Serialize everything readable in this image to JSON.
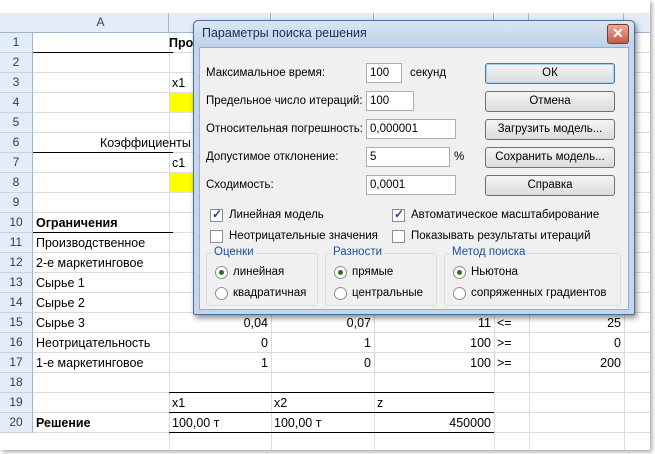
{
  "sheet": {
    "col_headers": [
      "A",
      "",
      "",
      "",
      "",
      ""
    ],
    "row_numbers": [
      "1",
      "2",
      "3",
      "4",
      "5",
      "6",
      "7",
      "8",
      "9",
      "10",
      "11",
      "12",
      "13",
      "14",
      "15",
      "16",
      "17",
      "18",
      "19",
      "20"
    ],
    "cells": {
      "b1": "Про",
      "c3_label": "x1",
      "a6": "Коэффициенты",
      "c7_label": "c1",
      "a10": "Ограничения",
      "a11": "Производственное",
      "a12": "2-е маркетинговое",
      "a13": "Сырье 1",
      "a14": "Сырье 2",
      "a15": "Сырье 3",
      "a16": "Неотрицательность",
      "a17": "1-е маркетинговое",
      "a20": "Решение",
      "r15": [
        "0,04",
        "0,07",
        "11",
        "<=",
        "25"
      ],
      "r16": [
        "0",
        "1",
        "100",
        ">=",
        "0"
      ],
      "r17": [
        "1",
        "0",
        "100",
        ">=",
        "200"
      ],
      "r19": [
        "x1",
        "x2",
        "z"
      ],
      "r20": [
        "100,00 т",
        "100,00 т",
        "450000"
      ]
    },
    "colors": {
      "highlight": "#ffff00",
      "header_bg": "#e4ecf7"
    }
  },
  "dialog": {
    "title": "Параметры поиска решения",
    "close_glyph": "✕",
    "fields": {
      "max_time_label": "Максимальное время:",
      "max_time_value": "100",
      "max_time_unit": "секунд",
      "max_iter_label": "Предельное число итераций:",
      "max_iter_value": "100",
      "precision_label": "Относительная погрешность:",
      "precision_value": "0,000001",
      "tolerance_label": "Допустимое отклонение:",
      "tolerance_value": "5",
      "tolerance_unit": "%",
      "convergence_label": "Сходимость:",
      "convergence_value": "0,0001"
    },
    "buttons": {
      "ok": "ОК",
      "cancel": "Отмена",
      "load": "Загрузить модель...",
      "save": "Сохранить модель...",
      "help": "Справка"
    },
    "checkboxes": {
      "linear": "Линейная модель",
      "auto_scale": "Автоматическое масштабирование",
      "non_negative": "Неотрицательные значения",
      "show_iter": "Показывать результаты итераций"
    },
    "groups": {
      "estimates": {
        "title": "Оценки",
        "opt1": "линейная",
        "opt2": "квадратичная"
      },
      "derivatives": {
        "title": "Разности",
        "opt1": "прямые",
        "opt2": "центральные"
      },
      "search": {
        "title": "Метод поиска",
        "opt1": "Ньютона",
        "opt2": "сопряженных градиентов"
      }
    }
  }
}
